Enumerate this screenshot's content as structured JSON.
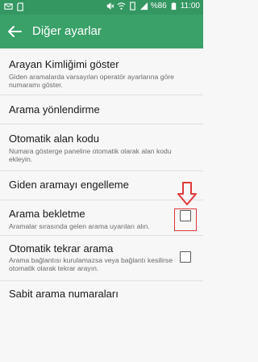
{
  "status_bar": {
    "battery_percent": "%86",
    "time": "11:00",
    "icons": [
      "message-icon",
      "sd-card-icon",
      "mute-icon",
      "wifi-icon",
      "sim-icon",
      "signal-icon",
      "battery-icon"
    ]
  },
  "app_bar": {
    "title": "Diğer ayarlar",
    "back_icon": "arrow-back-icon"
  },
  "settings": [
    {
      "title": "Arayan Kimliğimi göster",
      "subtitle": "Giden aramalarda varsayılan operatör ayarlarına göre numaramı göster."
    },
    {
      "title": "Arama yönlendirme"
    },
    {
      "title": "Otomatik alan kodu",
      "subtitle": "Numara gösterge paneline otomatik olarak alan kodu ekleyin."
    },
    {
      "title": "Giden aramayı engelleme"
    },
    {
      "title": "Arama bekletme",
      "subtitle": "Aramalar sırasında gelen arama uyarıları alın.",
      "checked": false
    },
    {
      "title": "Otomatik tekrar arama",
      "subtitle": "Arama bağlantısı kurulamazsa veya bağlantı kesilirse otomatik olarak tekrar arayın.",
      "checked": false
    },
    {
      "title": "Sabit arama numaraları"
    }
  ],
  "colors": {
    "status_bar": "#349762",
    "app_bar": "#3aa169",
    "annotation": "#e03a3a"
  }
}
